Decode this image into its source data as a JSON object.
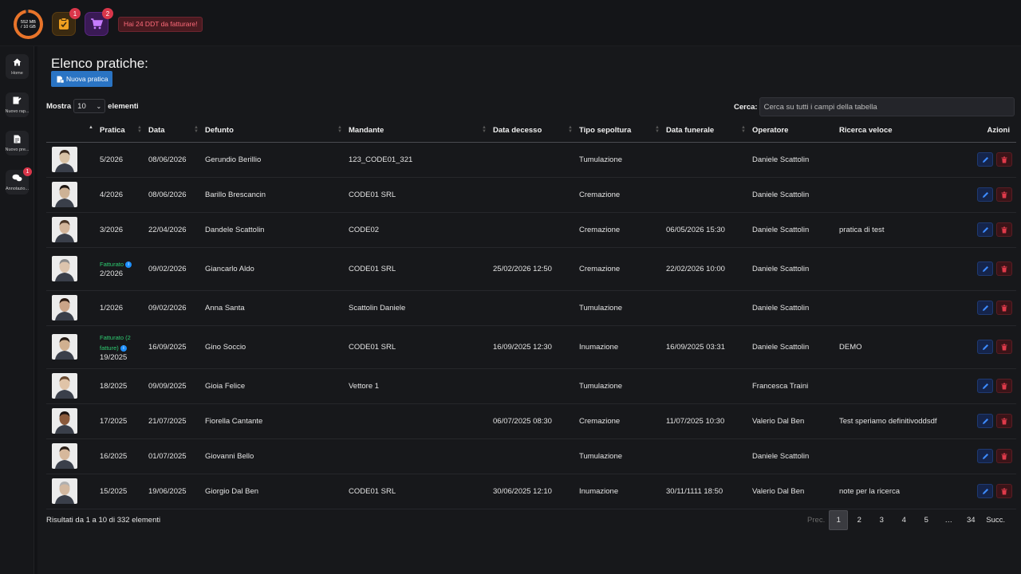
{
  "topbar": {
    "storage_used": "552 MB",
    "storage_total": "/ 10 GB",
    "clipboard_badge": "1",
    "cart_badge": "2",
    "alert_text": "Hai 24 DDT da fatturare!"
  },
  "sidebar": {
    "items": [
      {
        "label": "Home",
        "icon": "home-icon"
      },
      {
        "label": "Nuovo rap...",
        "icon": "report-icon"
      },
      {
        "label": "Nuovo pre...",
        "icon": "document-icon"
      },
      {
        "label": "Annotazio...",
        "icon": "chat-icon",
        "badge": "1"
      }
    ]
  },
  "page": {
    "title": "Elenco pratiche:",
    "new_button": "Nuova pratica",
    "show_label": "Mostra",
    "show_value": "10",
    "show_suffix": "elementi",
    "search_label": "Cerca:",
    "search_placeholder": "Cerca su tutti i campi della tabella"
  },
  "table": {
    "columns": [
      "",
      "Pratica",
      "Data",
      "Defunto",
      "Mandante",
      "Data decesso",
      "Tipo sepoltura",
      "Data funerale",
      "Operatore",
      "Ricerca veloce",
      "Azioni"
    ],
    "rows": [
      {
        "status": "",
        "pratica": "5/2026",
        "data": "08/06/2026",
        "defunto": "Gerundio Berillio",
        "mandante": "123_CODE01_321",
        "decesso": "",
        "sepoltura": "Tumulazione",
        "funerale": "",
        "operatore": "Daniele Scattolin",
        "ricerca": ""
      },
      {
        "status": "",
        "pratica": "4/2026",
        "data": "08/06/2026",
        "defunto": "Barillo Brescancin",
        "mandante": "CODE01 SRL",
        "decesso": "",
        "sepoltura": "Cremazione",
        "funerale": "",
        "operatore": "Daniele Scattolin",
        "ricerca": ""
      },
      {
        "status": "",
        "pratica": "3/2026",
        "data": "22/04/2026",
        "defunto": "Dandele Scattolin",
        "mandante": "CODE02",
        "decesso": "",
        "sepoltura": "Cremazione",
        "funerale": "06/05/2026 15:30",
        "operatore": "Daniele Scattolin",
        "ricerca": "pratica di test"
      },
      {
        "status": "Fatturato",
        "pratica": "2/2026",
        "data": "09/02/2026",
        "defunto": "Giancarlo Aldo",
        "mandante": "CODE01 SRL",
        "decesso": "25/02/2026 12:50",
        "sepoltura": "Cremazione",
        "funerale": "22/02/2026 10:00",
        "operatore": "Daniele Scattolin",
        "ricerca": ""
      },
      {
        "status": "",
        "pratica": "1/2026",
        "data": "09/02/2026",
        "defunto": "Anna Santa",
        "mandante": "Scattolin Daniele",
        "decesso": "",
        "sepoltura": "Tumulazione",
        "funerale": "",
        "operatore": "Daniele Scattolin",
        "ricerca": ""
      },
      {
        "status": "Fatturato (2 fatture)",
        "pratica": "19/2025",
        "data": "16/09/2025",
        "defunto": "Gino Soccio",
        "mandante": "CODE01 SRL",
        "decesso": "16/09/2025 12:30",
        "sepoltura": "Inumazione",
        "funerale": "16/09/2025 03:31",
        "operatore": "Daniele Scattolin",
        "ricerca": "DEMO"
      },
      {
        "status": "",
        "pratica": "18/2025",
        "data": "09/09/2025",
        "defunto": "Gioia Felice",
        "mandante": "Vettore 1",
        "decesso": "",
        "sepoltura": "Tumulazione",
        "funerale": "",
        "operatore": "Francesca Traini",
        "ricerca": ""
      },
      {
        "status": "",
        "pratica": "17/2025",
        "data": "21/07/2025",
        "defunto": "Fiorella Cantante",
        "mandante": "",
        "decesso": "06/07/2025 08:30",
        "sepoltura": "Cremazione",
        "funerale": "11/07/2025 10:30",
        "operatore": "Valerio Dal Ben",
        "ricerca": "Test speriamo definitivoddsdf"
      },
      {
        "status": "",
        "pratica": "16/2025",
        "data": "01/07/2025",
        "defunto": "Giovanni Bello",
        "mandante": "",
        "decesso": "",
        "sepoltura": "Tumulazione",
        "funerale": "",
        "operatore": "Daniele Scattolin",
        "ricerca": ""
      },
      {
        "status": "",
        "pratica": "15/2025",
        "data": "19/06/2025",
        "defunto": "Giorgio Dal Ben",
        "mandante": "CODE01 SRL",
        "decesso": "30/06/2025 12:10",
        "sepoltura": "Inumazione",
        "funerale": "30/11/1111 18:50",
        "operatore": "Valerio Dal Ben",
        "ricerca": "note per la ricerca"
      }
    ]
  },
  "footer": {
    "info": "Risultati da 1 a 10 di 332 elementi",
    "pages": [
      "Prec.",
      "1",
      "2",
      "3",
      "4",
      "5",
      "…",
      "34",
      "Succ."
    ]
  },
  "colors": {
    "accent": "#2a74c4",
    "status_green": "#2ecc71",
    "badge_red": "#d9364a",
    "storage_orange": "#e8742a"
  }
}
